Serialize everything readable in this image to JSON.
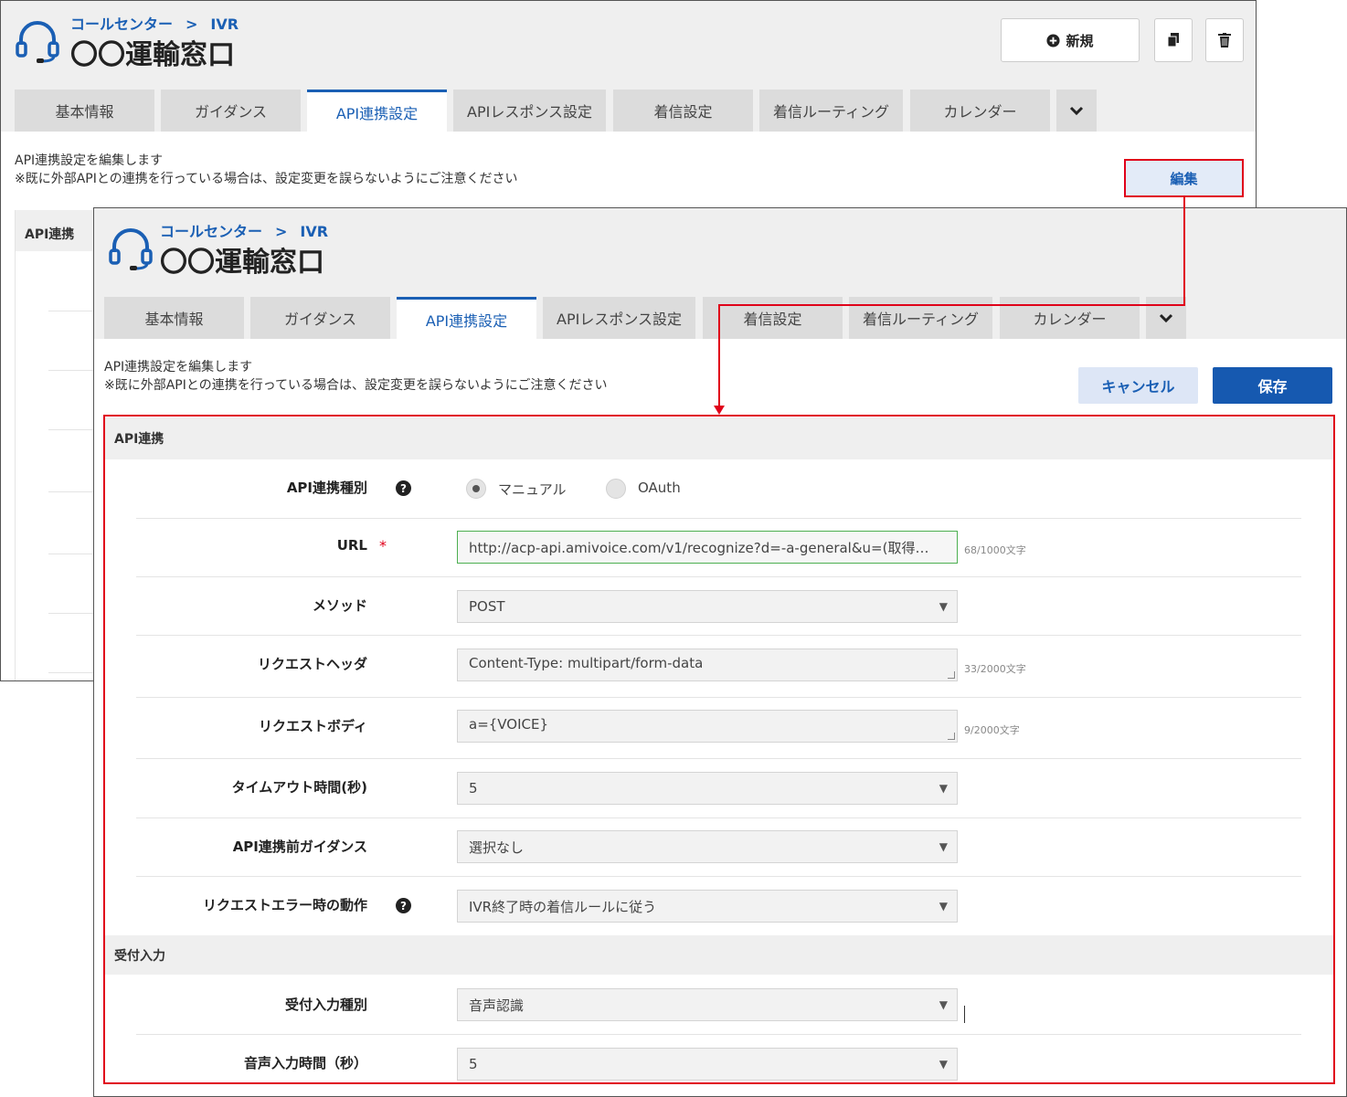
{
  "breadcrumb": {
    "parent": "コールセンター",
    "separator": ">",
    "current": "IVR"
  },
  "page_title": "〇〇運輸窓口",
  "header_buttons": {
    "new_label": "新規",
    "new_icon": "plus-circle-icon",
    "copy_icon": "copy-icon",
    "delete_icon": "trash-icon"
  },
  "tabs": [
    {
      "label": "基本情報"
    },
    {
      "label": "ガイダンス"
    },
    {
      "label": "API連携設定"
    },
    {
      "label": "APIレスポンス設定"
    },
    {
      "label": "着信設定"
    },
    {
      "label": "着信ルーティング"
    },
    {
      "label": "カレンダー"
    }
  ],
  "tab_more_icon": "chevron-down-icon",
  "description": {
    "line1": "API連携設定を編集します",
    "line2": "※既に外部APIとの連携を行っている場合は、設定変更を誤らないようにご注意ください"
  },
  "edit_button": "編集",
  "back_section_label": "API連携",
  "cancel_button": "キャンセル",
  "save_button": "保存",
  "help_glyph": "?",
  "required_mark": "*",
  "sections": {
    "api": "API連携",
    "reception": "受付入力"
  },
  "form": {
    "api_type": {
      "label": "API連携種別",
      "options": [
        "マニュアル",
        "OAuth"
      ],
      "selected": "マニュアル"
    },
    "url": {
      "label": "URL",
      "value": "http://acp-api.amivoice.com/v1/recognize?d=-a-general&u=(取得…",
      "count": "68/1000文字"
    },
    "method": {
      "label": "メソッド",
      "value": "POST"
    },
    "request_header": {
      "label": "リクエストヘッダ",
      "value": "Content-Type: multipart/form-data",
      "count": "33/2000文字"
    },
    "request_body": {
      "label": "リクエストボディ",
      "value": "a={VOICE}",
      "count": "9/2000文字"
    },
    "timeout": {
      "label": "タイムアウト時間(秒)",
      "value": "5"
    },
    "pre_guidance": {
      "label": "API連携前ガイダンス",
      "value": "選択なし"
    },
    "error_action": {
      "label": "リクエストエラー時の動作",
      "value": "IVR終了時の着信ルールに従う"
    },
    "reception_type": {
      "label": "受付入力種別",
      "value": "音声認識"
    },
    "voice_time": {
      "label": "音声入力時間（秒）",
      "value": "5"
    }
  },
  "colors": {
    "accent": "#1a5fb4",
    "highlight": "#e0001a",
    "save_bg": "#1659b0"
  }
}
